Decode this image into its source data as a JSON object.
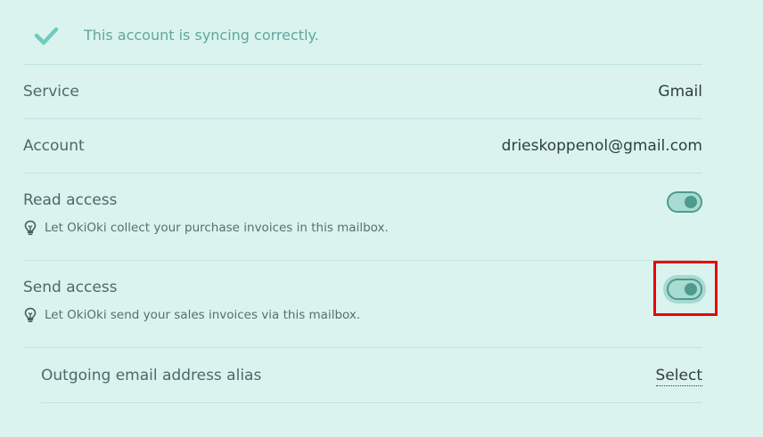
{
  "status": {
    "icon": "checkmark-icon",
    "text": "This account is syncing correctly."
  },
  "rows": {
    "service": {
      "label": "Service",
      "value": "Gmail"
    },
    "account": {
      "label": "Account",
      "value": "drieskoppenol@gmail.com"
    },
    "read_access": {
      "label": "Read access",
      "hint": "Let OkiOki collect your purchase invoices in this mailbox.",
      "enabled": true
    },
    "send_access": {
      "label": "Send access",
      "hint": "Let OkiOki send your sales invoices via this mailbox.",
      "enabled": true
    },
    "alias": {
      "label": "Outgoing email address alias",
      "action": "Select"
    }
  },
  "colors": {
    "background": "#daf3ef",
    "accent": "#4e9a8d",
    "check": "#6dcdbd",
    "highlight": "#ee0000"
  }
}
